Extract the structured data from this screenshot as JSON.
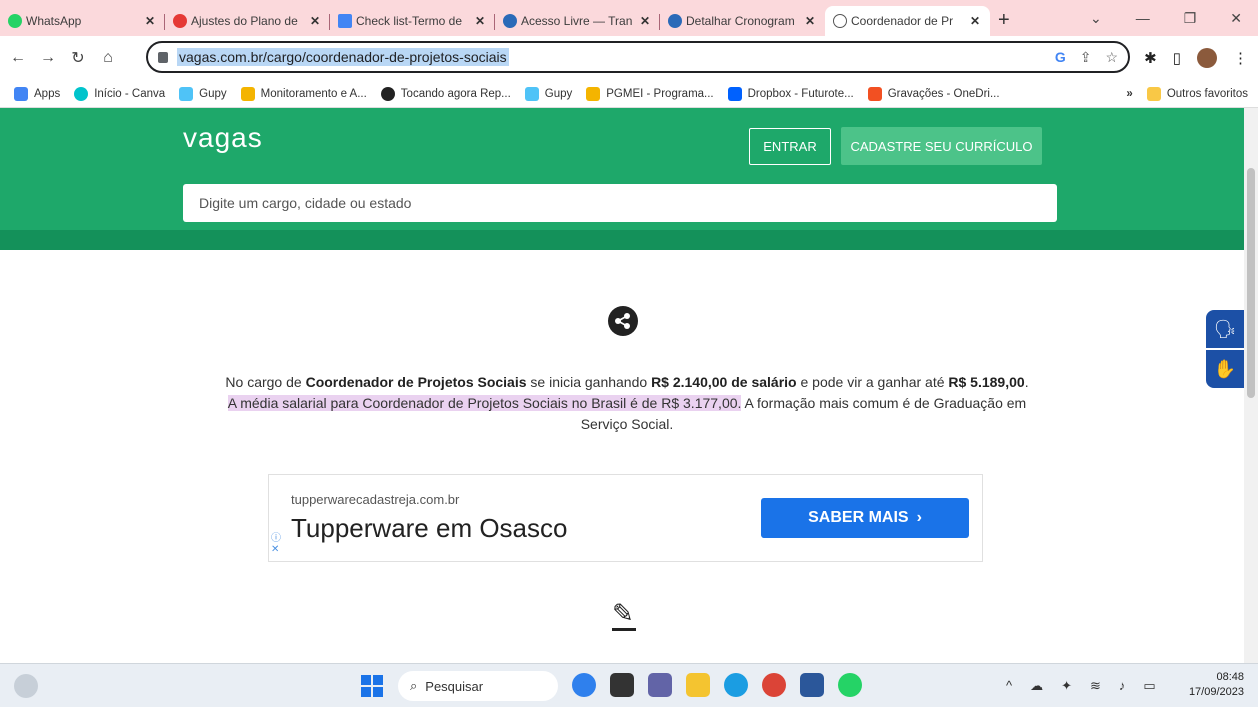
{
  "browser": {
    "tabs": [
      {
        "title": "WhatsApp",
        "favicon_color": "#25d366"
      },
      {
        "title": "Ajustes do Plano de",
        "favicon_color": "#e53935"
      },
      {
        "title": "Check list-Termo de",
        "favicon_color": "#4285f4"
      },
      {
        "title": "Acesso Livre — Tran",
        "favicon_color": "#2a6ab8"
      },
      {
        "title": "Detalhar Cronogram",
        "favicon_color": "#2a6ab8"
      },
      {
        "title": "Coordenador de Pr",
        "favicon_color": "#1ea86a",
        "active": true
      }
    ],
    "url": "vagas.com.br/cargo/coordenador-de-projetos-sociais",
    "bookmarks": [
      {
        "label": "Apps",
        "color": "#4285f4"
      },
      {
        "label": "Início - Canva",
        "color": "#00c4cc"
      },
      {
        "label": "Gupy",
        "color": "#4fc3f7"
      },
      {
        "label": "Monitoramento e A...",
        "color": "#f4b400"
      },
      {
        "label": "Tocando agora Rep...",
        "color": "#222222"
      },
      {
        "label": "Gupy",
        "color": "#4fc3f7"
      },
      {
        "label": "PGMEI - Programa...",
        "color": "#f4b400"
      },
      {
        "label": "Dropbox - Futurote...",
        "color": "#0061fe"
      },
      {
        "label": "Gravações - OneDri...",
        "color": "#f25022"
      }
    ],
    "other_bookmarks": "Outros favoritos"
  },
  "site": {
    "logo": "vagas",
    "login_label": "ENTRAR",
    "signup_label": "CADASTRE SEU CURRÍCULO",
    "search_placeholder": "Digite um cargo, cidade ou estado",
    "brand_color": "#1ea86a"
  },
  "content": {
    "p1": "No cargo de ",
    "b1": "Coordenador de Projetos Sociais",
    "p2": " se inicia ganhando ",
    "b2": "R$ 2.140,00 de salário",
    "p3": " e pode vir a ganhar até ",
    "b3": "R$ 5.189,00",
    "p4": ". ",
    "hl": "A média salarial para Coordenador de Projetos Sociais no Brasil é de R$ 3.177,00.",
    "p5": " A formação mais comum é de Graduação em Serviço Social."
  },
  "ad": {
    "domain": "tupperwarecadastreja.com.br",
    "headline": "Tupperware em Osasco",
    "cta": "SABER MAIS"
  },
  "taskbar": {
    "search_label": "Pesquisar",
    "time": "08:48",
    "date": "17/09/2023"
  }
}
